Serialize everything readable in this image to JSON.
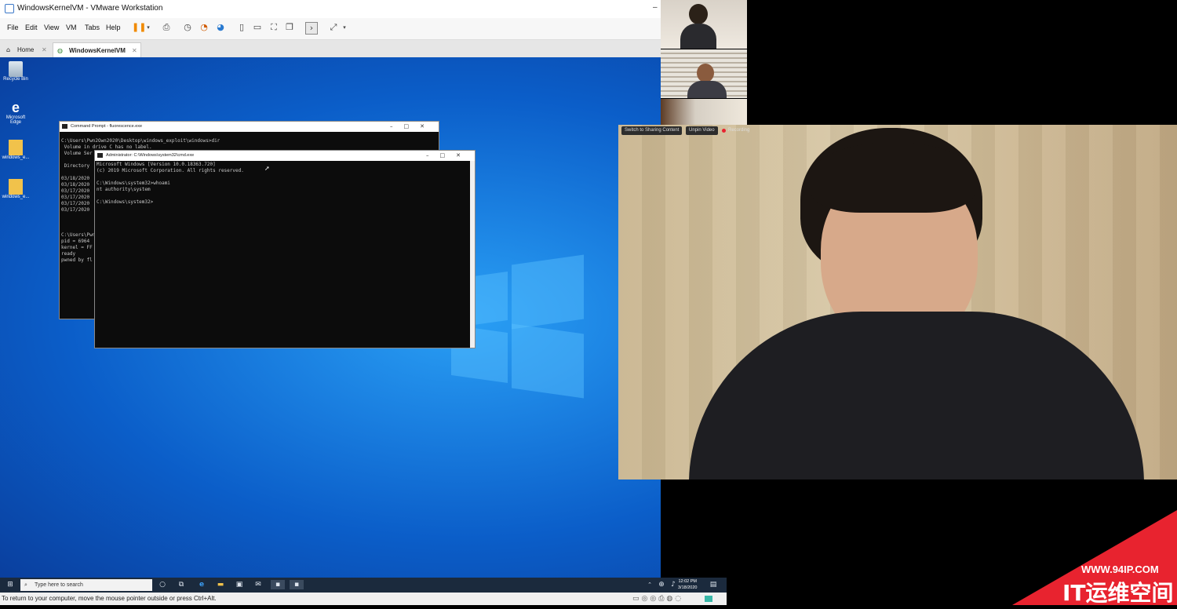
{
  "window": {
    "title": "WindowsKernelVM - VMware Workstation"
  },
  "menu": [
    "File",
    "Edit",
    "View",
    "VM",
    "Tabs",
    "Help"
  ],
  "tabs": {
    "home": "Home",
    "vm": "WindowsKernelVM"
  },
  "desktop_icons": [
    "Recycle Bin",
    "Microsoft Edge",
    "windows_e...",
    "windows_e..."
  ],
  "cmd1": {
    "title": "Command Prompt - fluorescence.exe",
    "lines": "C:\\Users\\Pwn2Own2020\\Desktop\\windows_exploit\\windows>dir\n Volume in drive C has no label.\n Volume Ser\n\n Directory\n\n03/18/2020\n03/18/2020\n03/17/2020\n03/17/2020\n03/17/2020\n03/17/2020\n\n\n\nC:\\Users\\Pwn\npid = 6964\nkernel = FF\nready\npwned by fl"
  },
  "cmd2": {
    "title": "Administrator: C:\\Windows\\system32\\cmd.exe",
    "lines": "Microsoft Windows [Version 10.0.18363.720]\n(c) 2019 Microsoft Corporation. All rights reserved.\n\nC:\\Windows\\system32>whoami\nnt authority\\system\n\nC:\\Windows\\system32>"
  },
  "taskbar": {
    "search_placeholder": "Type here to search",
    "time": "12:02 PM",
    "date": "3/18/2020"
  },
  "status": "To return to your computer, move the mouse pointer outside or press Ctrl+Alt.",
  "zoom": {
    "switch_label": "Switch to Sharing Content",
    "unpin_label": "Unpin Video",
    "recording_label": "Recording"
  },
  "watermark": {
    "url": "WWW.94IP.COM",
    "text": "IT运维空间"
  },
  "colors": {
    "accent": "#e8232f",
    "desktop": "#0b5ec9",
    "taskbar": "#1b2a3d"
  }
}
